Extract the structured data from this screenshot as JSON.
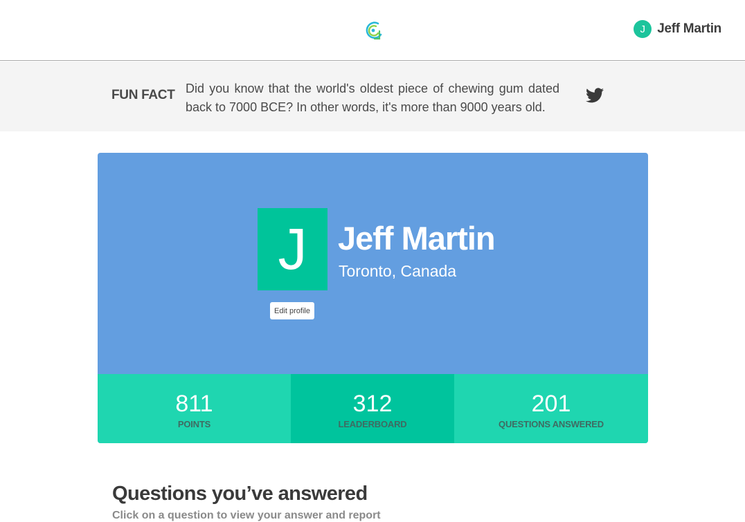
{
  "header": {
    "logo_icon": "app-logo-icon",
    "user": {
      "initial": "J",
      "name": "Jeff Martin",
      "avatar_color": "#1cc49c"
    }
  },
  "fun_fact": {
    "label": "FUN FACT",
    "text": "Did you know that the world's oldest piece of chewing gum dated back to 7000 BCE? In other words, it's more than 9000 years old.",
    "share_icon": "twitter-icon"
  },
  "profile": {
    "initial": "J",
    "name": "Jeff Martin",
    "location": "Toronto, Canada",
    "edit_label": "Edit profile",
    "card_color": "#639ee0",
    "avatar_color": "#00c49a"
  },
  "stats": [
    {
      "value": "811",
      "label": "POINTS"
    },
    {
      "value": "312",
      "label": "LEADERBOARD"
    },
    {
      "value": "201",
      "label": "QUESTIONS ANSWERED"
    }
  ],
  "stats_colors": {
    "default": "#1fd6b0",
    "active": "#00c49d"
  },
  "questions": {
    "title": "Questions you’ve answered",
    "subtitle": "Click on a question to view your answer and report"
  }
}
